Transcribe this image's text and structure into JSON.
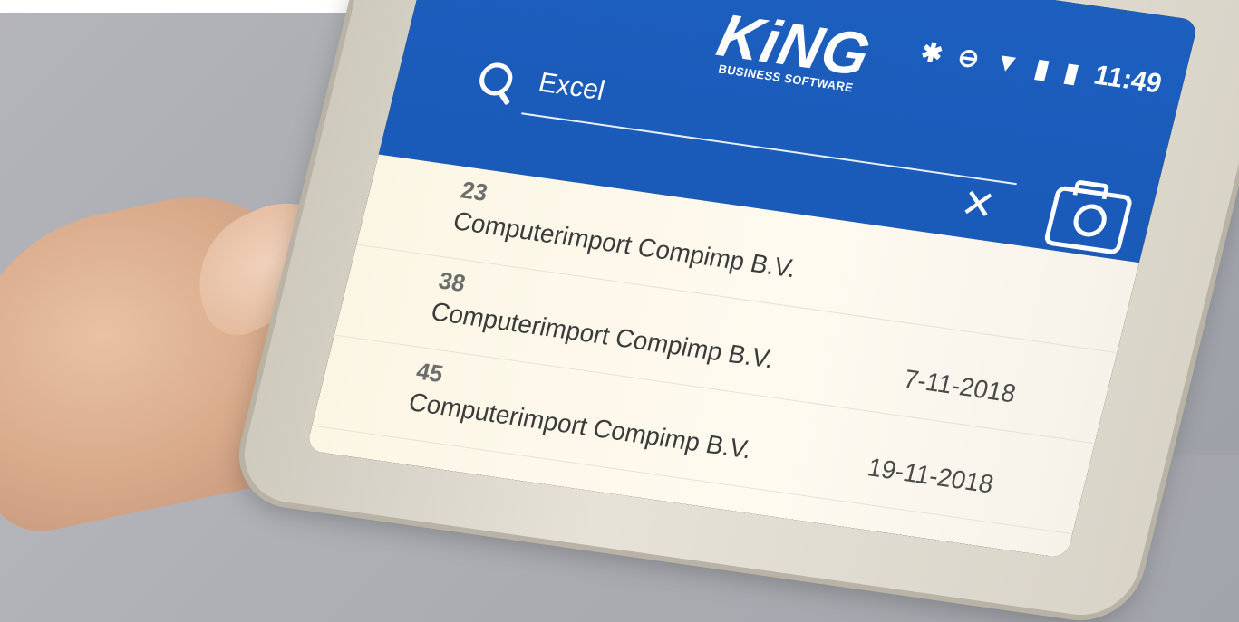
{
  "app": {
    "status_time": "11:49",
    "logo_text": "KiNG",
    "logo_subtitle": "BUSINESS SOFTWARE",
    "accent_color": "#1d5fbf"
  },
  "search": {
    "value": "Excel",
    "icon": "search-icon",
    "clear_icon": "close-icon",
    "camera_icon": "camera-icon"
  },
  "results": [
    {
      "number": "23",
      "name": "Computerimport Compimp B.V.",
      "date": ""
    },
    {
      "number": "38",
      "name": "Computerimport Compimp B.V.",
      "date": "7-11-2018"
    },
    {
      "number": "45",
      "name": "Computerimport Compimp B.V.",
      "date": "19-11-2018"
    }
  ]
}
